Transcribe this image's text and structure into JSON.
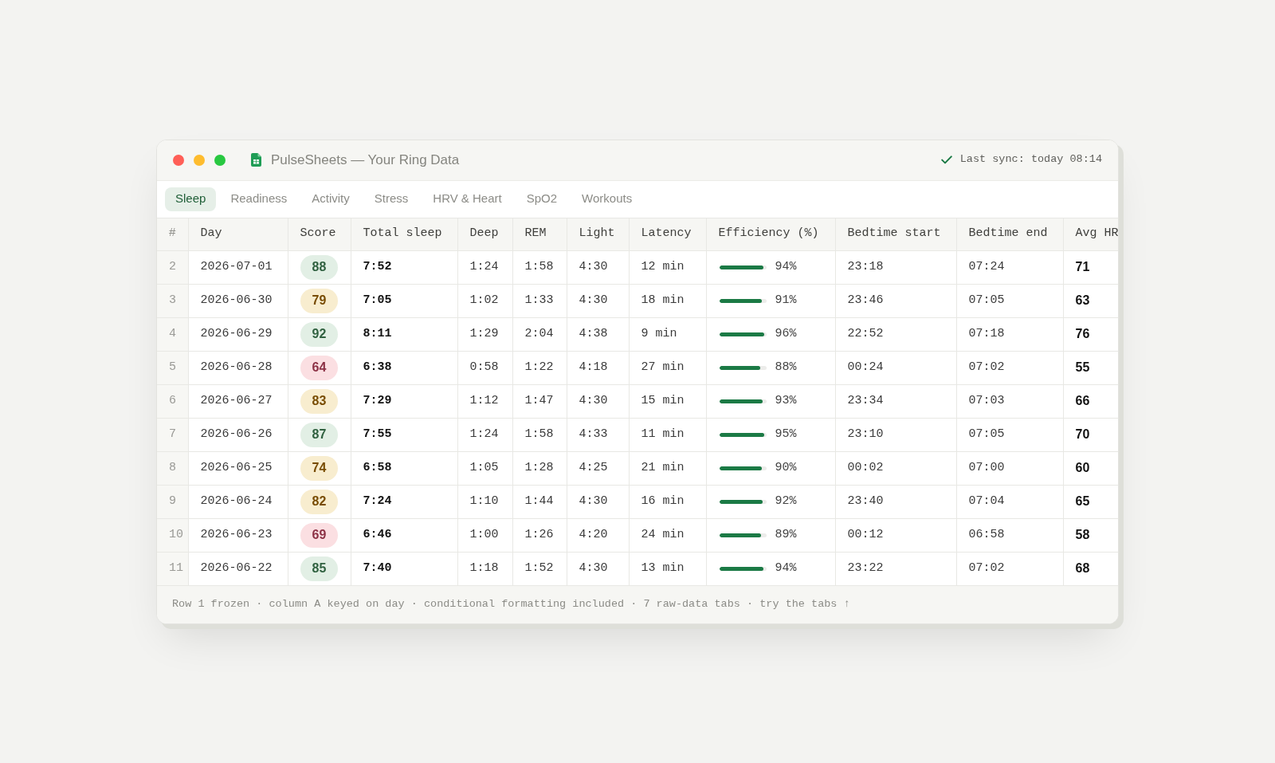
{
  "window": {
    "title": "PulseSheets — Your Ring Data",
    "sync": "Last sync: today 08:14"
  },
  "tabs": [
    {
      "label": "Sleep",
      "selected": true
    },
    {
      "label": "Readiness",
      "selected": false
    },
    {
      "label": "Activity",
      "selected": false
    },
    {
      "label": "Stress",
      "selected": false
    },
    {
      "label": "HRV & Heart",
      "selected": false
    },
    {
      "label": "SpO2",
      "selected": false
    },
    {
      "label": "Workouts",
      "selected": false
    }
  ],
  "table": {
    "columns": [
      "#",
      "Day",
      "Score",
      "Total sleep",
      "Deep",
      "REM",
      "Light",
      "Latency",
      "Efficiency (%)",
      "Bedtime start",
      "Bedtime end",
      "Avg HR"
    ],
    "rows": [
      {
        "row": "2",
        "day": "2026-07-01",
        "score": {
          "value": "88",
          "color": "#e2efe5"
        },
        "total_sleep": "7:52",
        "deep": "1:24",
        "rem": "1:58",
        "light": "4:30",
        "latency": "12 min",
        "efficiency": {
          "level": 0.94,
          "reading": "94%"
        },
        "bedtime_start": "23:18",
        "bedtime_end": "07:24",
        "avg_hr": "71"
      },
      {
        "row": "3",
        "day": "2026-06-30",
        "score": {
          "value": "79",
          "color": "#f8edcf"
        },
        "total_sleep": "7:05",
        "deep": "1:02",
        "rem": "1:33",
        "light": "4:30",
        "latency": "18 min",
        "efficiency": {
          "level": 0.91,
          "reading": "91%"
        },
        "bedtime_start": "23:46",
        "bedtime_end": "07:05",
        "avg_hr": "63"
      },
      {
        "row": "4",
        "day": "2026-06-29",
        "score": {
          "value": "92",
          "color": "#e2efe5"
        },
        "total_sleep": "8:11",
        "deep": "1:29",
        "rem": "2:04",
        "light": "4:38",
        "latency": "9 min",
        "efficiency": {
          "level": 0.96,
          "reading": "96%"
        },
        "bedtime_start": "22:52",
        "bedtime_end": "07:18",
        "avg_hr": "76"
      },
      {
        "row": "5",
        "day": "2026-06-28",
        "score": {
          "value": "64",
          "color": "#fbdfe2"
        },
        "total_sleep": "6:38",
        "deep": "0:58",
        "rem": "1:22",
        "light": "4:18",
        "latency": "27 min",
        "efficiency": {
          "level": 0.88,
          "reading": "88%"
        },
        "bedtime_start": "00:24",
        "bedtime_end": "07:02",
        "avg_hr": "55"
      },
      {
        "row": "6",
        "day": "2026-06-27",
        "score": {
          "value": "83",
          "color": "#f8edcf"
        },
        "total_sleep": "7:29",
        "deep": "1:12",
        "rem": "1:47",
        "light": "4:30",
        "latency": "15 min",
        "efficiency": {
          "level": 0.93,
          "reading": "93%"
        },
        "bedtime_start": "23:34",
        "bedtime_end": "07:03",
        "avg_hr": "66"
      },
      {
        "row": "7",
        "day": "2026-06-26",
        "score": {
          "value": "87",
          "color": "#e2efe5"
        },
        "total_sleep": "7:55",
        "deep": "1:24",
        "rem": "1:58",
        "light": "4:33",
        "latency": "11 min",
        "efficiency": {
          "level": 0.95,
          "reading": "95%"
        },
        "bedtime_start": "23:10",
        "bedtime_end": "07:05",
        "avg_hr": "70"
      },
      {
        "row": "8",
        "day": "2026-06-25",
        "score": {
          "value": "74",
          "color": "#f8edcf"
        },
        "total_sleep": "6:58",
        "deep": "1:05",
        "rem": "1:28",
        "light": "4:25",
        "latency": "21 min",
        "efficiency": {
          "level": 0.9,
          "reading": "90%"
        },
        "bedtime_start": "00:02",
        "bedtime_end": "07:00",
        "avg_hr": "60"
      },
      {
        "row": "9",
        "day": "2026-06-24",
        "score": {
          "value": "82",
          "color": "#f8edcf"
        },
        "total_sleep": "7:24",
        "deep": "1:10",
        "rem": "1:44",
        "light": "4:30",
        "latency": "16 min",
        "efficiency": {
          "level": 0.92,
          "reading": "92%"
        },
        "bedtime_start": "23:40",
        "bedtime_end": "07:04",
        "avg_hr": "65"
      },
      {
        "row": "10",
        "day": "2026-06-23",
        "score": {
          "value": "69",
          "color": "#fbdfe2"
        },
        "total_sleep": "6:46",
        "deep": "1:00",
        "rem": "1:26",
        "light": "4:20",
        "latency": "24 min",
        "efficiency": {
          "level": 0.89,
          "reading": "89%"
        },
        "bedtime_start": "00:12",
        "bedtime_end": "06:58",
        "avg_hr": "58"
      },
      {
        "row": "11",
        "day": "2026-06-22",
        "score": {
          "value": "85",
          "color": "#e2efe5"
        },
        "total_sleep": "7:40",
        "deep": "1:18",
        "rem": "1:52",
        "light": "4:30",
        "latency": "13 min",
        "efficiency": {
          "level": 0.94,
          "reading": "94%"
        },
        "bedtime_start": "23:22",
        "bedtime_end": "07:02",
        "avg_hr": "68"
      }
    ]
  },
  "status_bar": {
    "text": "Row 1 frozen · column A keyed on day · conditional formatting included · 7 raw-data tabs · try the tabs ↑"
  }
}
